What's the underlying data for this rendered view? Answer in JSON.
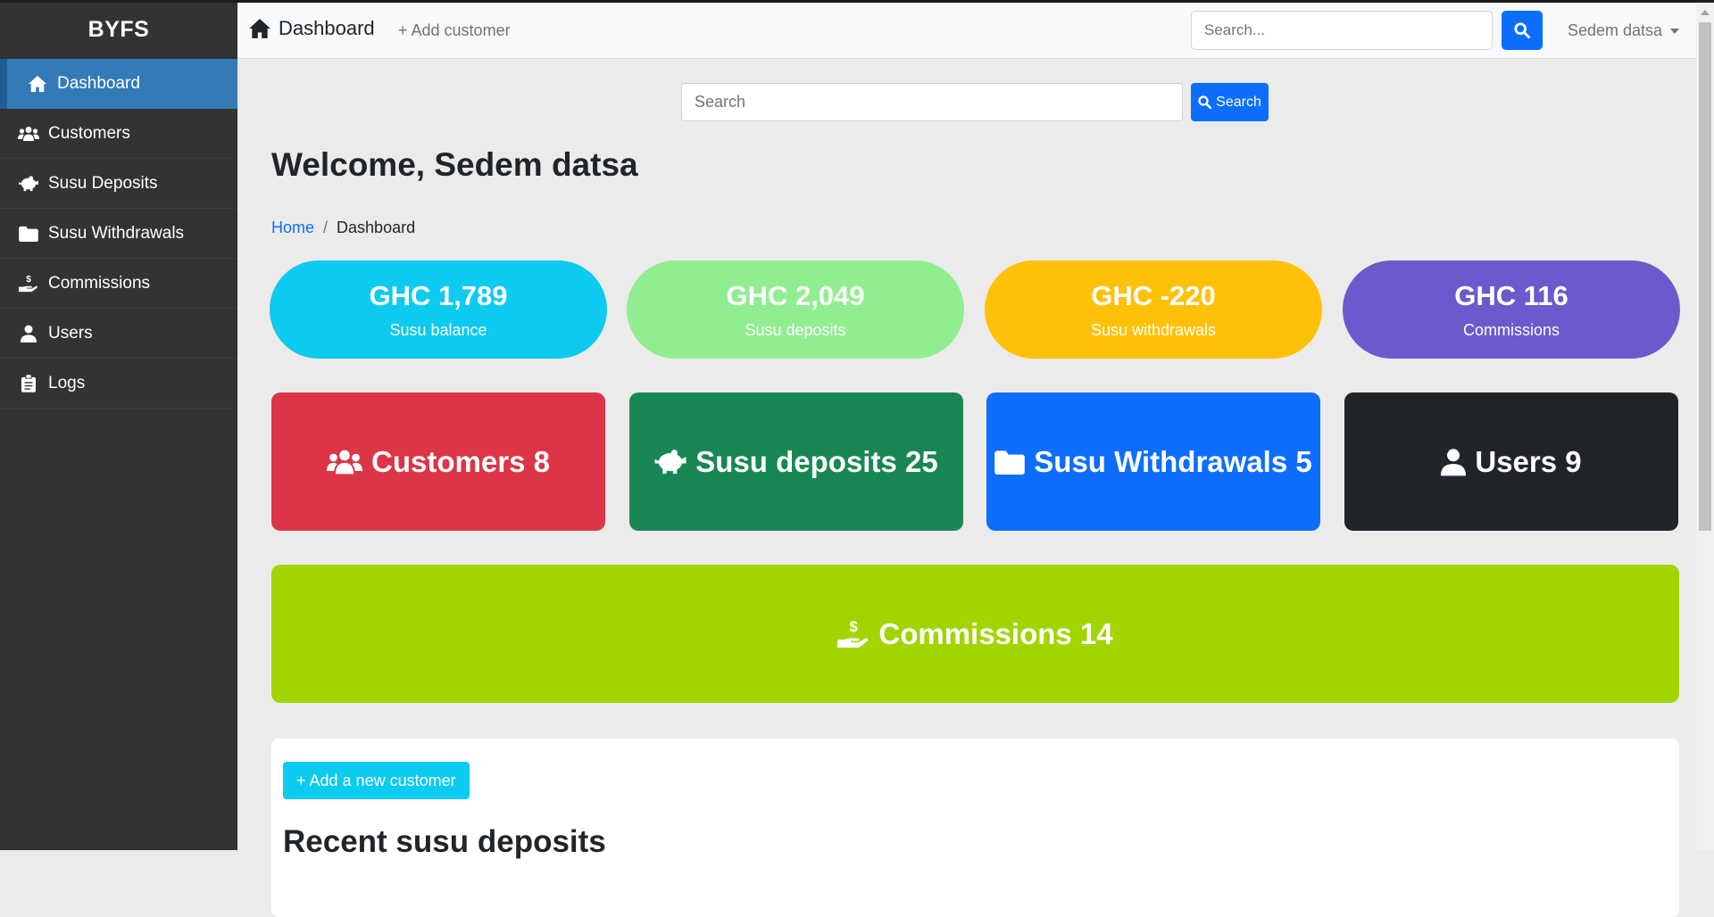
{
  "brand": "BYFS",
  "sidebar": {
    "items": [
      {
        "label": "Dashboard",
        "icon": "home-icon"
      },
      {
        "label": "Customers",
        "icon": "users-icon"
      },
      {
        "label": "Susu Deposits",
        "icon": "piggy-bank-icon"
      },
      {
        "label": "Susu Withdrawals",
        "icon": "folder-icon"
      },
      {
        "label": "Commissions",
        "icon": "hand-dollar-icon"
      },
      {
        "label": "Users",
        "icon": "user-icon"
      },
      {
        "label": "Logs",
        "icon": "clipboard-icon"
      }
    ]
  },
  "topbar": {
    "page_title": "Dashboard",
    "add_customer": "+ Add customer",
    "search_placeholder": "Search...",
    "user_name": "Sedem datsa"
  },
  "main": {
    "search_placeholder": "Search",
    "search_button": "Search",
    "welcome": "Welcome, Sedem datsa",
    "breadcrumb": {
      "home": "Home",
      "separator": "/",
      "current": "Dashboard"
    },
    "summary": [
      {
        "amount": "GHC 1,789",
        "label": "Susu balance",
        "color": "#0dcaf0"
      },
      {
        "amount": "GHC 2,049",
        "label": "Susu deposits",
        "color": "#90ee90"
      },
      {
        "amount": "GHC -220",
        "label": "Susu withdrawals",
        "color": "#ffc107"
      },
      {
        "amount": "GHC 116",
        "label": "Commissions",
        "color": "#6a5acd"
      }
    ],
    "cards": [
      {
        "label": "Customers 8",
        "color": "#dc3545"
      },
      {
        "label": "Susu deposits 25",
        "color": "#198754"
      },
      {
        "label": "Susu Withdrawals 5",
        "color": "#0d6efd"
      },
      {
        "label": "Users 9",
        "color": "#212529"
      }
    ],
    "commissions_card": {
      "label": "Commissions 14",
      "color": "#a2d400"
    },
    "add_new_customer": "+ Add a new customer",
    "recent_title": "Recent susu deposits"
  }
}
